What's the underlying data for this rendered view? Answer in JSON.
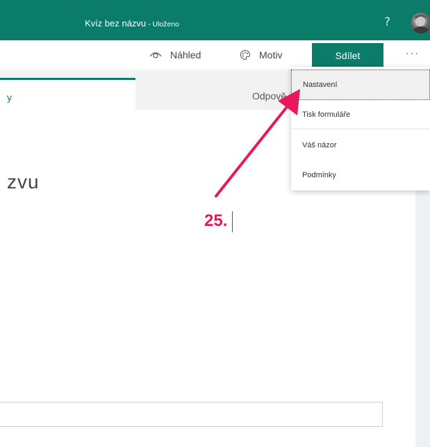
{
  "header": {
    "title": "Kvíz bez názvu",
    "separator": " - ",
    "status": "Uloženo",
    "help_label": "?"
  },
  "toolbar": {
    "preview_label": "Náhled",
    "theme_label": "Motiv",
    "share_label": "Sdílet",
    "more_label": "···"
  },
  "tabs": {
    "questions_label": "y",
    "responses_label": "Odpově"
  },
  "form": {
    "title_fragment": "zvu"
  },
  "menu": {
    "items": [
      {
        "label": "Nastavení"
      },
      {
        "label": "Tisk formuláře"
      },
      {
        "label": "Váš názor"
      },
      {
        "label": "Podmínky"
      }
    ]
  },
  "annotation": {
    "step_label": "25."
  },
  "colors": {
    "brand": "#0b7b6a",
    "annotation": "#e8195a"
  }
}
